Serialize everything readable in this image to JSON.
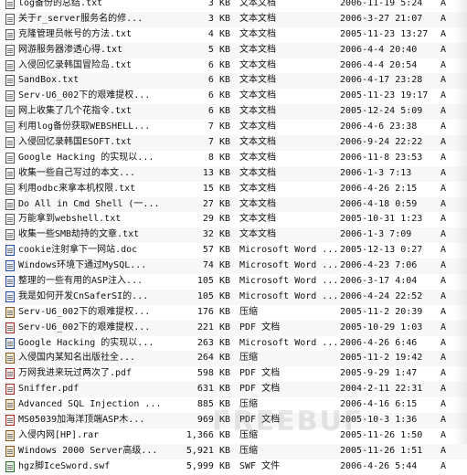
{
  "files": [
    {
      "name": "log备份的总结.txt",
      "size": "3 KB",
      "type": "文本文档",
      "modified": "2006-11-19 5:24",
      "attr": "A",
      "icon": "txt-file-icon"
    },
    {
      "name": "关于r_server服务名的修...",
      "size": "3 KB",
      "type": "文本文档",
      "modified": "2006-3-27 21:07",
      "attr": "A",
      "icon": "txt-file-icon"
    },
    {
      "name": "克隆管理员帐号的方法.txt",
      "size": "4 KB",
      "type": "文本文档",
      "modified": "2005-11-23 13:27",
      "attr": "A",
      "icon": "txt-file-icon"
    },
    {
      "name": "网游服务器渗透心得.txt",
      "size": "5 KB",
      "type": "文本文档",
      "modified": "2006-4-4 20:40",
      "attr": "A",
      "icon": "txt-file-icon"
    },
    {
      "name": "入侵回忆录韩国冒险岛.txt",
      "size": "6 KB",
      "type": "文本文档",
      "modified": "2006-4-4 20:54",
      "attr": "A",
      "icon": "txt-file-icon"
    },
    {
      "name": "SandBox.txt",
      "size": "6 KB",
      "type": "文本文档",
      "modified": "2006-4-17 23:28",
      "attr": "A",
      "icon": "txt-file-icon"
    },
    {
      "name": "Serv-U6_002下的艰难提权...",
      "size": "6 KB",
      "type": "文本文档",
      "modified": "2005-11-23 19:17",
      "attr": "A",
      "icon": "txt-file-icon"
    },
    {
      "name": "网上收集了几个花指令.txt",
      "size": "6 KB",
      "type": "文本文档",
      "modified": "2005-12-24 5:09",
      "attr": "A",
      "icon": "txt-file-icon"
    },
    {
      "name": "利用log备份获取WEBSHELL...",
      "size": "7 KB",
      "type": "文本文档",
      "modified": "2006-4-6 23:38",
      "attr": "A",
      "icon": "txt-file-icon"
    },
    {
      "name": "入侵回忆录韩国ESOFT.txt",
      "size": "7 KB",
      "type": "文本文档",
      "modified": "2006-9-24 22:22",
      "attr": "A",
      "icon": "txt-file-icon"
    },
    {
      "name": "Google Hacking 的实现以...",
      "size": "8 KB",
      "type": "文本文档",
      "modified": "2006-11-8 23:53",
      "attr": "A",
      "icon": "txt-file-icon"
    },
    {
      "name": "收集一些自己写过的本文...",
      "size": "13 KB",
      "type": "文本文档",
      "modified": "2006-1-3 7:13",
      "attr": "A",
      "icon": "txt-file-icon"
    },
    {
      "name": "利用odbc来拿本机权限.txt",
      "size": "15 KB",
      "type": "文本文档",
      "modified": "2006-4-26 2:15",
      "attr": "A",
      "icon": "txt-file-icon"
    },
    {
      "name": "Do All in Cmd Shell (一...",
      "size": "27 KB",
      "type": "文本文档",
      "modified": "2006-4-18 0:59",
      "attr": "A",
      "icon": "txt-file-icon"
    },
    {
      "name": "万能拿到webshell.txt",
      "size": "29 KB",
      "type": "文本文档",
      "modified": "2005-10-31 1:23",
      "attr": "A",
      "icon": "txt-file-icon"
    },
    {
      "name": "收集一些SMB劫持的文章.txt",
      "size": "32 KB",
      "type": "文本文档",
      "modified": "2006-1-3 7:09",
      "attr": "A",
      "icon": "txt-file-icon"
    },
    {
      "name": "cookie注射拿下一网站.doc",
      "size": "57 KB",
      "type": "Microsoft Word ...",
      "modified": "2005-12-13 0:27",
      "attr": "A",
      "icon": "word-doc-icon"
    },
    {
      "name": "Windows环境下通过MySQL...",
      "size": "74 KB",
      "type": "Microsoft Word ...",
      "modified": "2006-4-23 7:06",
      "attr": "A",
      "icon": "word-doc-icon"
    },
    {
      "name": "整理的一些有用的ASP注入...",
      "size": "105 KB",
      "type": "Microsoft Word ...",
      "modified": "2006-3-17 4:04",
      "attr": "A",
      "icon": "word-doc-icon"
    },
    {
      "name": "我是如何开发CnSaferSI的...",
      "size": "105 KB",
      "type": "Microsoft Word ...",
      "modified": "2006-4-24 22:52",
      "attr": "A",
      "icon": "word-doc-icon"
    },
    {
      "name": "Serv-U6_002下的艰难提权...",
      "size": "176 KB",
      "type": "压缩",
      "modified": "2005-11-2 20:39",
      "attr": "A",
      "icon": "archive-icon"
    },
    {
      "name": "Serv-U6_002下的艰难提权...",
      "size": "221 KB",
      "type": "PDF 文档",
      "modified": "2005-10-29 1:03",
      "attr": "A",
      "icon": "pdf-file-icon"
    },
    {
      "name": "Google Hacking 的实现以...",
      "size": "263 KB",
      "type": "Microsoft Word ...",
      "modified": "2006-4-26 6:46",
      "attr": "A",
      "icon": "word-doc-icon"
    },
    {
      "name": "入侵国内某知名出版社全...",
      "size": "264 KB",
      "type": "压缩",
      "modified": "2005-11-2 19:42",
      "attr": "A",
      "icon": "archive-icon"
    },
    {
      "name": "万网我进来玩过两次了.pdf",
      "size": "598 KB",
      "type": "PDF 文档",
      "modified": "2005-9-29 1:47",
      "attr": "A",
      "icon": "pdf-file-icon"
    },
    {
      "name": "Sniffer.pdf",
      "size": "631 KB",
      "type": "PDF 文档",
      "modified": "2004-2-11 22:31",
      "attr": "A",
      "icon": "pdf-file-icon"
    },
    {
      "name": "Advanced SQL Injection ...",
      "size": "885 KB",
      "type": "压缩",
      "modified": "2006-4-16 6:15",
      "attr": "A",
      "icon": "archive-icon"
    },
    {
      "name": "MS05039加海洋顶端ASP木...",
      "size": "969 KB",
      "type": "PDF 文档",
      "modified": "2005-10-3 1:36",
      "attr": "A",
      "icon": "pdf-file-icon"
    },
    {
      "name": "入侵内网[HP].rar",
      "size": "1,366 KB",
      "type": "压缩",
      "modified": "2005-11-26 1:50",
      "attr": "A",
      "icon": "archive-icon"
    },
    {
      "name": "Windows 2000 Server高级...",
      "size": "5,921 KB",
      "type": "压缩",
      "modified": "2005-11-26 1:51",
      "attr": "A",
      "icon": "archive-icon"
    },
    {
      "name": "hgz脚IceSword.swf",
      "size": "5,999 KB",
      "type": "SWF 文件",
      "modified": "2006-4-26 5:44",
      "attr": "A",
      "icon": "flash-file-icon"
    }
  ],
  "watermark": "FREEBUF"
}
